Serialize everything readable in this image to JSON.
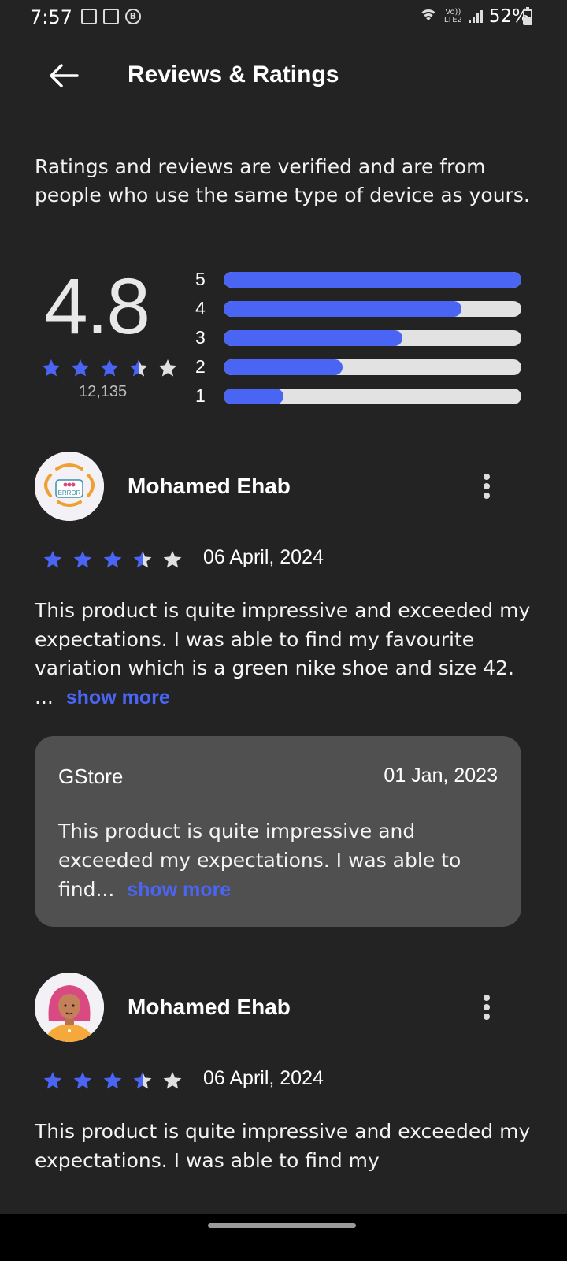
{
  "status_bar": {
    "time": "7:57",
    "volte_top": "Vo))",
    "volte_bottom": "LTE2",
    "battery": "52%"
  },
  "header": {
    "title": "Reviews & Ratings",
    "back_icon": "arrow-left-icon"
  },
  "intro_text": "Ratings and reviews are verified and are from people who use the same type of device as yours.",
  "summary": {
    "average": "4.8",
    "stars_value": 3.5,
    "count": "12,135",
    "distribution": [
      {
        "label": "5",
        "fraction": 1.0
      },
      {
        "label": "4",
        "fraction": 0.8
      },
      {
        "label": "3",
        "fraction": 0.6
      },
      {
        "label": "2",
        "fraction": 0.4
      },
      {
        "label": "1",
        "fraction": 0.2
      }
    ]
  },
  "colors": {
    "accent": "#4a65f4",
    "background": "#232323",
    "star_empty": "#e0e0e0"
  },
  "reviews": [
    {
      "name": "Mohamed Ehab",
      "rating": 3.5,
      "date": "06 April, 2024",
      "body": "This product is quite impressive and exceeded my expectations. I was able to find my favourite variation which is a green nike shoe and size 42. ...",
      "show_more": "show more",
      "reply": {
        "store": "GStore",
        "date": "01 Jan, 2023",
        "body": "This product is quite impressive and exceeded my expectations. I was able to find...",
        "show_more": "show more"
      }
    },
    {
      "name": "Mohamed Ehab",
      "rating": 3.5,
      "date": "06 April, 2024",
      "body": "This product is quite impressive and exceeded my expectations. I was able to find my"
    }
  ]
}
